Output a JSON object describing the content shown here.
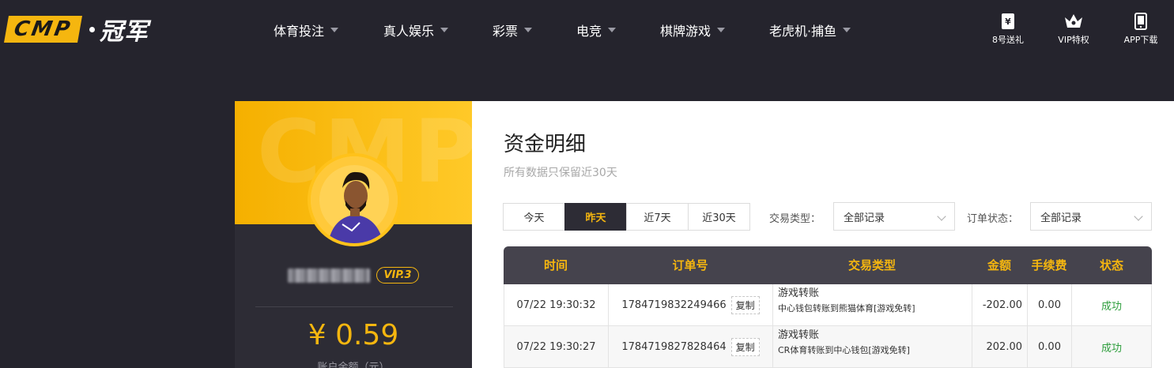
{
  "brand": {
    "logo_letters": "CMP",
    "logo_cn": "冠军"
  },
  "nav": {
    "items": [
      {
        "label": "体育投注"
      },
      {
        "label": "真人娱乐"
      },
      {
        "label": "彩票"
      },
      {
        "label": "电竞"
      },
      {
        "label": "棋牌游戏"
      },
      {
        "label": "老虎机·捕鱼"
      }
    ]
  },
  "quick_links": [
    {
      "label": "8号送礼",
      "icon": "gift-ticket-icon"
    },
    {
      "label": "VIP特权",
      "icon": "crown-icon"
    },
    {
      "label": "APP下载",
      "icon": "phone-icon"
    }
  ],
  "profile": {
    "watermark": "CMP",
    "vip_badge": "VIP.3",
    "balance": "¥ 0.59",
    "balance_label": "账户余额（元）"
  },
  "main": {
    "title": "资金明细",
    "subtitle": "所有数据只保留近30天",
    "date_tabs": [
      {
        "label": "今天",
        "active": false
      },
      {
        "label": "昨天",
        "active": true
      },
      {
        "label": "近7天",
        "active": false
      },
      {
        "label": "近30天",
        "active": false
      }
    ],
    "type_filter": {
      "label": "交易类型：",
      "value": "全部记录"
    },
    "status_filter": {
      "label": "订单状态：",
      "value": "全部记录"
    }
  },
  "table": {
    "headers": [
      "时间",
      "订单号",
      "交易类型",
      "金额",
      "手续费",
      "状态"
    ],
    "copy_label": "复制",
    "rows": [
      {
        "time": "07/22 19:30:32",
        "order_no": "1784719832249466",
        "type_main": "游戏转账",
        "type_sub": "中心钱包转账到熊猫体育[游戏免转]",
        "amount": "-202.00",
        "fee": "0.00",
        "status": "成功"
      },
      {
        "time": "07/22 19:30:27",
        "order_no": "1784719827828464",
        "type_main": "游戏转账",
        "type_sub": "CR体育转账到中心钱包[游戏免转]",
        "amount": "202.00",
        "fee": "0.00",
        "status": "成功"
      }
    ]
  },
  "colors": {
    "accent": "#f5b60f",
    "dark_bg": "#25242d",
    "success": "#2e9e3d"
  }
}
